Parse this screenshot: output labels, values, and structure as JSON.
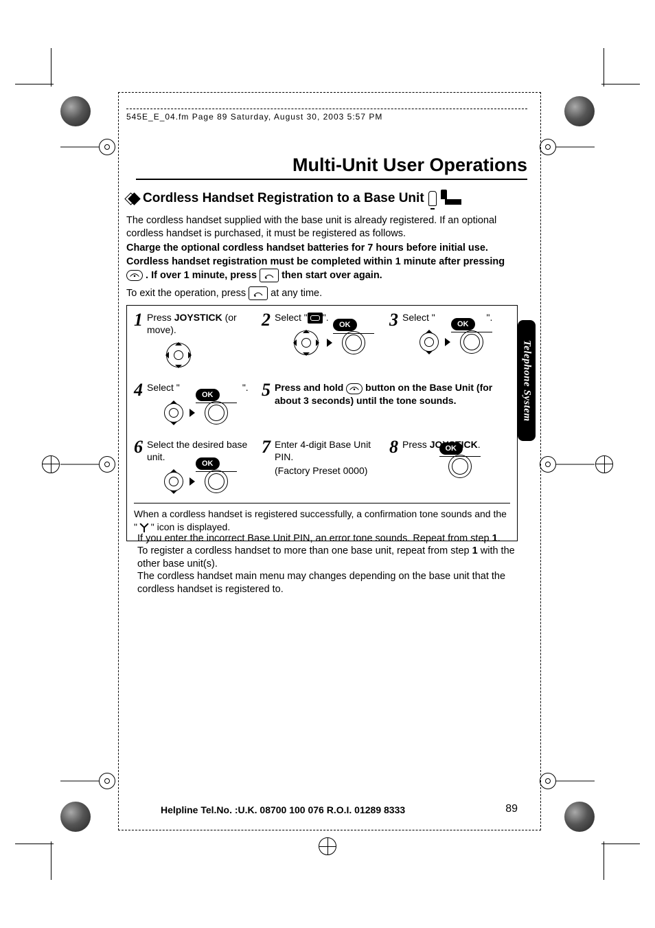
{
  "header": "545E_E_04.fm  Page 89  Saturday, August 30, 2003  5:57 PM",
  "page_title": "Multi-Unit User Operations",
  "side_tab": "Telephone System",
  "section_title": "Cordless Handset Registration to a Base Unit",
  "intro_1": "The cordless handset supplied with the base unit is already registered. If an optional cordless handset is purchased, it must be registered as follows.",
  "bold_1": "Charge the optional cordless handset batteries for 7 hours before initial use.",
  "bold_2a": "Cordless handset registration must be completed within 1 minute after pressing ",
  "bold_2b": ". If over 1 minute, press ",
  "bold_2c": " then start over again.",
  "exit_line_a": "To exit the operation, press ",
  "exit_line_b": " at any time.",
  "ok_label": "OK",
  "steps": {
    "s1": {
      "num": "1",
      "a": "Press ",
      "b": "JOYSTICK",
      "c": " (or move)."
    },
    "s2": {
      "num": "2",
      "a": "Select \"",
      "b": "\"."
    },
    "s3": {
      "num": "3",
      "a": "Select \"",
      "b": "\"."
    },
    "s4": {
      "num": "4",
      "a": "Select \"",
      "b": "\"."
    },
    "s5": {
      "num": "5",
      "a": "Press and hold ",
      "b": " button on the Base Unit (for about 3 seconds) until the tone sounds."
    },
    "s6": {
      "num": "6",
      "a": "Select the desired base unit."
    },
    "s7": {
      "num": "7",
      "a": "Enter 4-digit Base Unit PIN.",
      "b": "(Factory Preset 0000)"
    },
    "s8": {
      "num": "8",
      "a": "Press ",
      "b": "JOYSTICK",
      "c": "."
    }
  },
  "step_note_a": "When a cordless handset is registered successfully, a confirmation tone sounds and the \" ",
  "step_note_b": " \" icon is displayed.",
  "post_1a": "If you enter the incorrect Base Unit PIN, an error tone sounds. Repeat from step ",
  "post_1b": "1",
  "post_1c": ".",
  "post_2a": "To register a cordless handset to more than one base unit, repeat from step ",
  "post_2b": "1",
  "post_2c": " with the other base unit(s).",
  "post_3": "The cordless handset main menu may changes depending on the base unit that the cordless handset is registered to.",
  "footer": "Helpline Tel.No. :U.K. 08700 100 076  R.O.I. 01289 8333",
  "page_number": "89"
}
